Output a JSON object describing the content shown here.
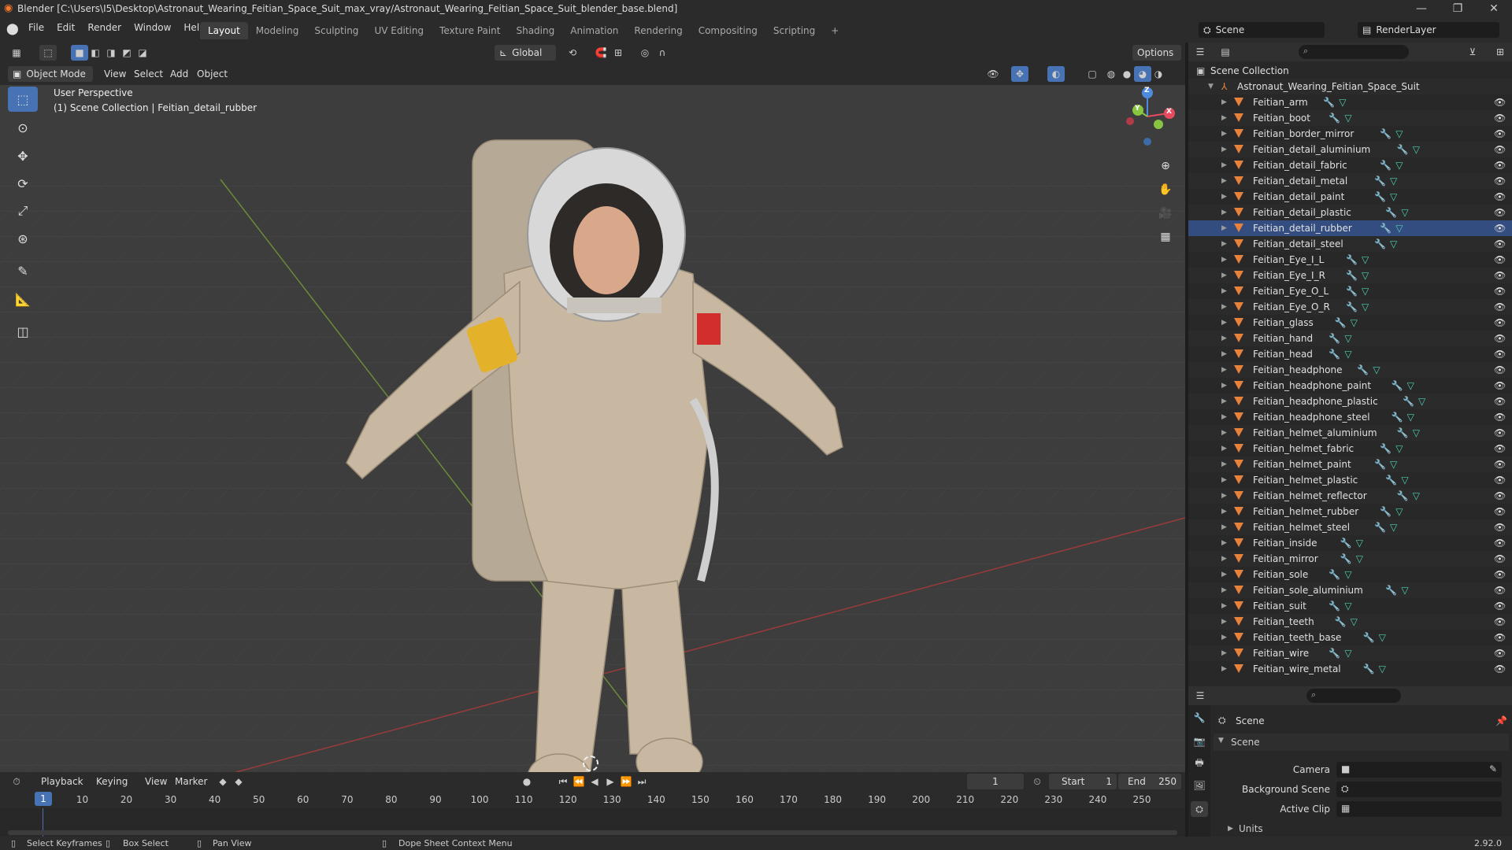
{
  "window": {
    "title": "Blender [C:\\Users\\I5\\Desktop\\Astronaut_Wearing_Feitian_Space_Suit_max_vray/Astronaut_Wearing_Feitian_Space_Suit_blender_base.blend]"
  },
  "menubar": {
    "items": [
      "File",
      "Edit",
      "Render",
      "Window",
      "Help"
    ],
    "workspaces": [
      "Layout",
      "Modeling",
      "Sculpting",
      "UV Editing",
      "Texture Paint",
      "Shading",
      "Animation",
      "Rendering",
      "Compositing",
      "Scripting"
    ],
    "active_workspace": "Layout",
    "add_tab": "+",
    "scene_label": "Scene",
    "renderlayer_label": "RenderLayer"
  },
  "toolbar": {
    "transform_orientation": "Global",
    "options_label": "Options"
  },
  "viewport_header": {
    "mode": "Object Mode",
    "menus": [
      "View",
      "Select",
      "Add",
      "Object"
    ]
  },
  "viewport": {
    "perspective_label": "User Perspective",
    "collection_info": "(1) Scene Collection | Feitian_detail_rubber",
    "gizmo_axes": {
      "z": "Z",
      "y": "Y",
      "x": "X"
    },
    "colors": {
      "x_axis": "#e84a5f",
      "y_axis": "#88c540",
      "z_axis": "#4c8bdd"
    }
  },
  "left_tools": [
    "select-box",
    "cursor",
    "move",
    "rotate",
    "scale",
    "transform",
    "annotate",
    "measure",
    "add-cube"
  ],
  "outliner": {
    "search_placeholder": "",
    "scene_collection": "Scene Collection",
    "root": "Astronaut_Wearing_Feitian_Space_Suit",
    "objects": [
      "Feitian_arm",
      "Feitian_boot",
      "Feitian_border_mirror",
      "Feitian_detail_aluminium",
      "Feitian_detail_fabric",
      "Feitian_detail_metal",
      "Feitian_detail_paint",
      "Feitian_detail_plastic",
      "Feitian_detail_rubber",
      "Feitian_detail_steel",
      "Feitian_Eye_I_L",
      "Feitian_Eye_I_R",
      "Feitian_Eye_O_L",
      "Feitian_Eye_O_R",
      "Feitian_glass",
      "Feitian_hand",
      "Feitian_head",
      "Feitian_headphone",
      "Feitian_headphone_paint",
      "Feitian_headphone_plastic",
      "Feitian_headphone_steel",
      "Feitian_helmet_aluminium",
      "Feitian_helmet_fabric",
      "Feitian_helmet_paint",
      "Feitian_helmet_plastic",
      "Feitian_helmet_reflector",
      "Feitian_helmet_rubber",
      "Feitian_helmet_steel",
      "Feitian_inside",
      "Feitian_mirror",
      "Feitian_sole",
      "Feitian_sole_aluminium",
      "Feitian_suit",
      "Feitian_teeth",
      "Feitian_teeth_base",
      "Feitian_wire",
      "Feitian_wire_metal"
    ],
    "selected": "Feitian_detail_rubber"
  },
  "properties": {
    "context": "Scene",
    "panel": "Scene",
    "camera_label": "Camera",
    "background_label": "Background Scene",
    "clip_label": "Active Clip",
    "units_label": "Units"
  },
  "timeline": {
    "menus": [
      "Playback",
      "Keying",
      "View",
      "Marker"
    ],
    "current_frame": "1",
    "start_label": "Start",
    "start_value": "1",
    "end_label": "End",
    "end_value": "250",
    "ticks": [
      "10",
      "20",
      "30",
      "40",
      "50",
      "60",
      "70",
      "80",
      "90",
      "100",
      "110",
      "120",
      "130",
      "140",
      "150",
      "160",
      "170",
      "180",
      "190",
      "200",
      "210",
      "220",
      "230",
      "240",
      "250"
    ],
    "playhead": "1"
  },
  "statusbar": {
    "select": "Select Keyframes",
    "box": "Box Select",
    "pan": "Pan View",
    "context": "Dope Sheet Context Menu",
    "version": "2.92.0"
  }
}
